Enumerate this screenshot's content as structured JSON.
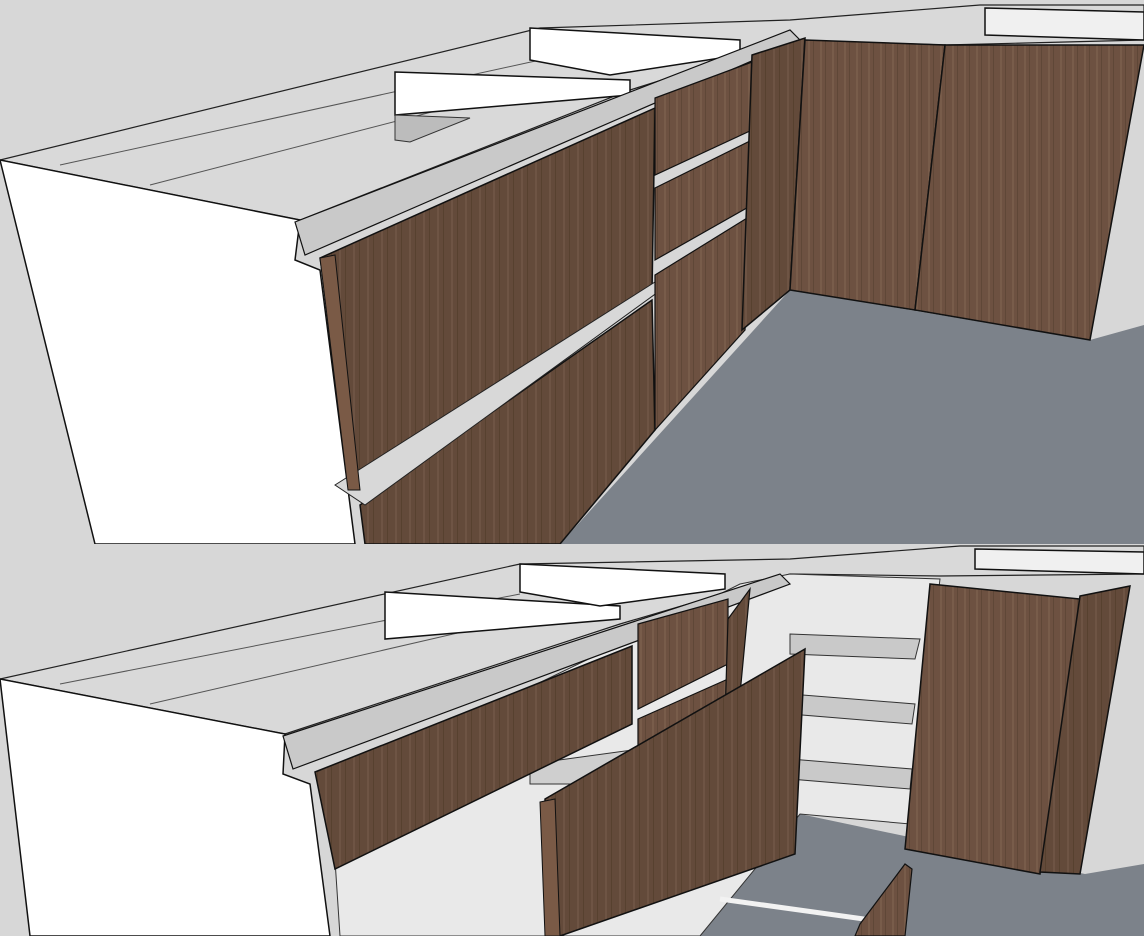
{
  "scene": {
    "description_visible_text": "",
    "views": [
      {
        "id": "closed-state",
        "state": "doors-closed"
      },
      {
        "id": "open-state",
        "state": "doors-open"
      }
    ]
  },
  "colors": {
    "background_floor_left": "#d6d6d6",
    "floor": "#7d838b",
    "countertop": "#d9d9d9",
    "carcass_white": "#ffffff",
    "wood_dark": "#5e4636",
    "wood_mid": "#6c5242",
    "wood_edge": "#7a5a46",
    "interior_shadow": "#bdbdbd",
    "outline": "#111111"
  }
}
